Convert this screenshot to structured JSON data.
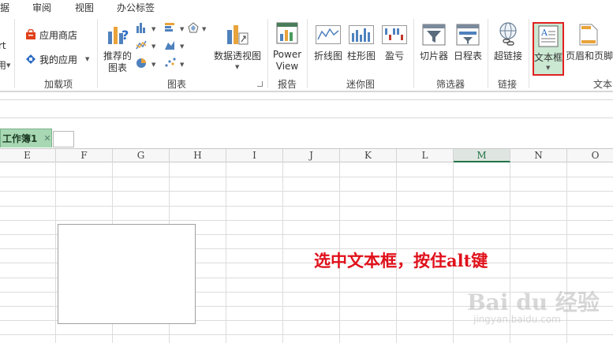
{
  "menu": {
    "tabs": [
      "据",
      "审阅",
      "视图",
      "办公标签"
    ]
  },
  "ribbon": {
    "cut_texts": [
      "rt",
      "用"
    ],
    "addins": {
      "store": "应用商店",
      "my_apps": "我的应用",
      "group_label": "加载项"
    },
    "charts": {
      "recommended_line1": "推荐的",
      "recommended_line2": "图表",
      "pivot_chart": "数据透视图",
      "group_label": "图表"
    },
    "reports": {
      "power_line1": "Power",
      "power_line2": "View",
      "group_label": "报告"
    },
    "sparklines": {
      "line": "折线图",
      "column": "柱形图",
      "winloss": "盈亏",
      "group_label": "迷你图"
    },
    "filters": {
      "slicer": "切片器",
      "timeline": "日程表",
      "group_label": "筛选器"
    },
    "links": {
      "hyperlink": "超链接",
      "group_label": "链接"
    },
    "text": {
      "textbox": "文本框",
      "header_footer": "页眉和页脚",
      "group_label": "文本"
    }
  },
  "sheet": {
    "workbook_tab": "工作簿1",
    "close_glyph": "✕",
    "columns": [
      "E",
      "F",
      "G",
      "H",
      "I",
      "J",
      "K",
      "L",
      "M",
      "N",
      "O"
    ],
    "selected_column": "M"
  },
  "annotation": "选中文本框，按住alt键",
  "watermark": {
    "brand": "Bai du 经验",
    "url": "jingyan.baidu.com"
  },
  "colors": {
    "accent_green": "#217346",
    "highlight_red": "#e0101a",
    "sheet_tab": "#a7d8b3"
  }
}
